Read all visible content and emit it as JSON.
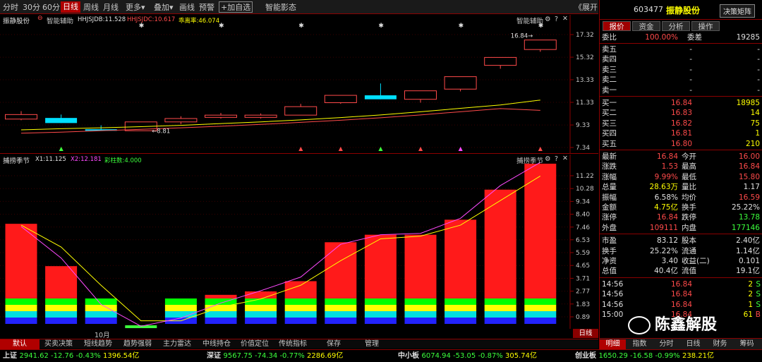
{
  "toolbar": {
    "items": [
      "分时",
      "30分",
      "60分",
      "日线",
      "周线",
      "月线",
      "更多",
      "叠加",
      "画线",
      "预警",
      "加自选",
      "智能影态"
    ],
    "active": "日线",
    "add_fav_plus": "+",
    "more_caret": "▾",
    "expand_label": "展开",
    "expand_arrows": "《"
  },
  "upper": {
    "stock_name": "振静股份",
    "indicator_tag": "智能辅助",
    "l1": "HHJSJDB:11.528",
    "l2": "HHJSJDC:10.617",
    "l3": "乖离率:46.074",
    "right_label": "智能辅助",
    "axis": [
      "17.32",
      "15.32",
      "13.33",
      "11.33",
      "9.33",
      "7.34"
    ],
    "price_note": "16.84",
    "low_note": "8.81",
    "candles": [
      {
        "o": 9.85,
        "c": 10.25,
        "h": 10.55,
        "l": 9.75,
        "t": "u"
      },
      {
        "o": 9.95,
        "c": 9.5,
        "h": 10.25,
        "l": 9.5,
        "t": "c"
      },
      {
        "o": 8.95,
        "c": 8.82,
        "h": 9.3,
        "l": 8.81,
        "t": "c"
      },
      {
        "o": 8.82,
        "c": 9.6,
        "h": 9.6,
        "l": 8.82,
        "t": "u"
      },
      {
        "o": 9.6,
        "c": 9.9,
        "h": 10.1,
        "l": 9.4,
        "t": "u"
      },
      {
        "o": 10.0,
        "c": 10.2,
        "h": 10.4,
        "l": 9.9,
        "t": "u"
      },
      {
        "o": 10.0,
        "c": 10.2,
        "h": 10.35,
        "l": 9.9,
        "t": "u"
      },
      {
        "o": 10.2,
        "c": 10.95,
        "h": 11.2,
        "l": 10.2,
        "t": "u"
      },
      {
        "o": 11.3,
        "c": 11.95,
        "h": 11.95,
        "l": 11.2,
        "t": "u"
      },
      {
        "o": 11.6,
        "c": 11.95,
        "h": 13.0,
        "l": 11.6,
        "t": "c"
      },
      {
        "o": 11.6,
        "c": 12.35,
        "h": 12.35,
        "l": 11.3,
        "t": "u"
      },
      {
        "o": 12.5,
        "c": 13.6,
        "h": 13.6,
        "l": 12.3,
        "t": "u"
      },
      {
        "o": 14.6,
        "c": 15.3,
        "h": 15.3,
        "l": 14.3,
        "t": "u"
      },
      {
        "o": 16.0,
        "c": 16.84,
        "h": 16.84,
        "l": 15.8,
        "t": "u"
      }
    ],
    "ma_yellow": [
      8.9,
      9.0,
      9.08,
      9.18,
      9.3,
      9.45,
      9.6,
      9.78,
      9.98,
      10.22,
      10.5,
      10.8,
      11.1,
      11.53
    ],
    "ma_red": [
      8.6,
      8.7,
      8.82,
      8.95,
      9.08,
      9.22,
      9.38,
      9.56,
      9.75,
      9.97,
      10.22,
      10.5,
      10.78,
      10.62
    ],
    "stars": [
      3,
      5,
      7,
      9,
      11,
      13
    ],
    "arrows": [
      {
        "i": 1,
        "c": "#3cff3c"
      },
      {
        "i": 7,
        "c": "#ff4a4a"
      },
      {
        "i": 8,
        "c": "#ff4a4a"
      },
      {
        "i": 9,
        "c": "#3cff3c"
      },
      {
        "i": 10,
        "c": "#ff4a4a"
      },
      {
        "i": 11,
        "c": "#ff4aff"
      },
      {
        "i": 13,
        "c": "#ff4a4a"
      }
    ]
  },
  "lower": {
    "title": "捕捞季节",
    "l1": "X1:11.125",
    "l2": "X2:12.181",
    "l3": "彩柱数:4.000",
    "right_label": "捕捞季节",
    "axis": [
      "11.22",
      "10.28",
      "9.34",
      "8.40",
      "7.46",
      "6.53",
      "5.59",
      "4.65",
      "3.71",
      "2.77",
      "1.83",
      "0.89"
    ],
    "bars": [
      7.7,
      4.6,
      1.1,
      0.1,
      1.1,
      2.5,
      2.75,
      3.5,
      6.35,
      6.9,
      6.9,
      8.0,
      10.2,
      12.1
    ],
    "line_yellow": [
      7.6,
      6.0,
      3.2,
      0.6,
      0.6,
      1.6,
      2.2,
      3.2,
      5.0,
      6.6,
      6.8,
      7.6,
      9.4,
      11.2
    ],
    "line_mag": [
      7.5,
      5.2,
      1.8,
      0.2,
      0.8,
      1.9,
      2.8,
      3.8,
      6.2,
      6.9,
      7.0,
      8.1,
      10.5,
      12.2
    ]
  },
  "x_axis": {
    "month": "10月",
    "period": "日线"
  },
  "bottom_tabs": [
    "默认",
    "买卖决策",
    "短线趋势",
    "趋势强弱",
    "主力雷达",
    "中线持仓",
    "价值定位",
    "传统指标",
    "保存",
    "管理"
  ],
  "right": {
    "code": "603477",
    "name": "振静股份",
    "decision_btn": "决策矩阵",
    "tabs": [
      "报价",
      "资金",
      "分析",
      "操作"
    ],
    "weibi": {
      "label": "委比",
      "value": "100.00%",
      "label2": "委差",
      "value2": "19285"
    },
    "sells": [
      {
        "label": "卖五",
        "price": "-",
        "vol": "-"
      },
      {
        "label": "卖四",
        "price": "-",
        "vol": "-"
      },
      {
        "label": "卖三",
        "price": "-",
        "vol": "-"
      },
      {
        "label": "卖二",
        "price": "-",
        "vol": "-"
      },
      {
        "label": "卖一",
        "price": "-",
        "vol": "-"
      }
    ],
    "buys": [
      {
        "label": "买一",
        "price": "16.84",
        "vol": "18985"
      },
      {
        "label": "买二",
        "price": "16.83",
        "vol": "14"
      },
      {
        "label": "买三",
        "price": "16.82",
        "vol": "75"
      },
      {
        "label": "买四",
        "price": "16.81",
        "vol": "1"
      },
      {
        "label": "买五",
        "price": "16.80",
        "vol": "210"
      }
    ],
    "stats": [
      {
        "l1": "最新",
        "v1": "16.84",
        "c1": "up",
        "l2": "今开",
        "v2": "16.00",
        "c2": "up"
      },
      {
        "l1": "涨跌",
        "v1": "1.53",
        "c1": "up",
        "l2": "最高",
        "v2": "16.84",
        "c2": "up"
      },
      {
        "l1": "涨幅",
        "v1": "9.99%",
        "c1": "up",
        "l2": "最低",
        "v2": "15.80",
        "c2": "up"
      },
      {
        "l1": "总量",
        "v1": "28.63万",
        "c1": "yl",
        "l2": "量比",
        "v2": "1.17",
        "c2": "wh"
      },
      {
        "l1": "振幅",
        "v1": "6.58%",
        "c1": "wh",
        "l2": "均价",
        "v2": "16.59",
        "c2": "up"
      },
      {
        "l1": "金额",
        "v1": "4.75亿",
        "c1": "yl",
        "l2": "换手",
        "v2": "25.22%",
        "c2": "wh"
      },
      {
        "l1": "涨停",
        "v1": "16.84",
        "c1": "up",
        "l2": "跌停",
        "v2": "13.78",
        "c2": "dn"
      },
      {
        "l1": "外盘",
        "v1": "109111",
        "c1": "up",
        "l2": "内盘",
        "v2": "177146",
        "c2": "dn"
      }
    ],
    "fund": [
      {
        "l1": "市盈",
        "v1": "83.12",
        "l2": "股本",
        "v2": "2.40亿"
      },
      {
        "l1": "换手",
        "v1": "25.22%",
        "l2": "流通",
        "v2": "1.14亿"
      },
      {
        "l1": "净资",
        "v1": "3.40",
        "l2": "收益(二)",
        "v2": "0.101"
      },
      {
        "l1": "总值",
        "v1": "40.4亿",
        "l2": "流值",
        "v2": "19.1亿"
      }
    ],
    "ticks": [
      {
        "t": "14:56",
        "p": "16.84",
        "v": "2",
        "s": "S"
      },
      {
        "t": "14:56",
        "p": "16.84",
        "v": "2",
        "s": "S"
      },
      {
        "t": "14:56",
        "p": "16.84",
        "v": "1",
        "s": "S"
      },
      {
        "t": "15:00",
        "p": "16.84",
        "v": "61",
        "s": "B"
      }
    ],
    "watermark": "陈鑫解股",
    "bottom_tabs": [
      "明细",
      "指数",
      "分时",
      "日线",
      "财务",
      "筹码"
    ]
  },
  "status": [
    {
      "name": "上证",
      "price": "2941.62",
      "chg": "-12.76",
      "pct": "-0.43%",
      "amt": "1396.54亿"
    },
    {
      "name": "深证",
      "price": "9567.75",
      "chg": "-74.34",
      "pct": "-0.77%",
      "amt": "2286.69亿"
    },
    {
      "name": "中小板",
      "price": "6074.94",
      "chg": "-53.05",
      "pct": "-0.87%",
      "amt": "305.74亿"
    },
    {
      "name": "创业板",
      "price": "1650.29",
      "chg": "-16.58",
      "pct": "-0.99%",
      "amt": "238.21亿"
    }
  ]
}
